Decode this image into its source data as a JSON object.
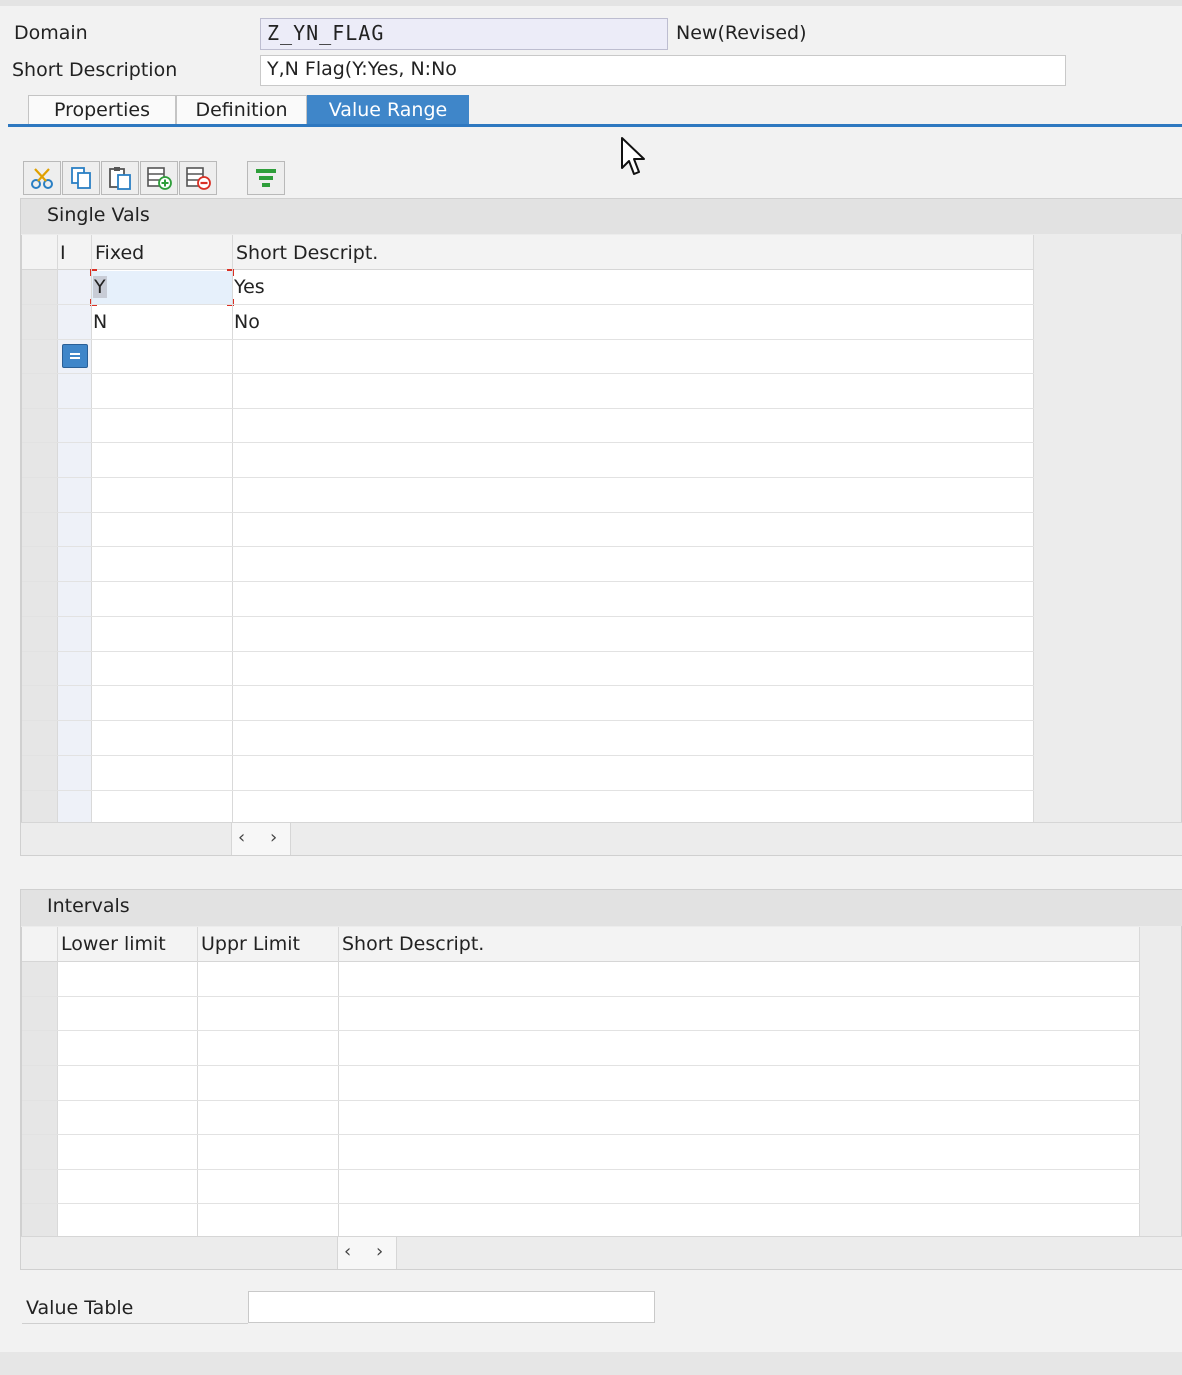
{
  "header": {
    "domain_label": "Domain",
    "domain_value": "Z_YN_FLAG",
    "status": "New(Revised)",
    "short_desc_label": "Short Description",
    "short_desc_value": "Y,N Flag(Y:Yes, N:No"
  },
  "tabs": [
    {
      "label": "Properties",
      "active": false
    },
    {
      "label": "Definition",
      "active": false
    },
    {
      "label": "Value Range",
      "active": true
    }
  ],
  "toolbar": {
    "icons": [
      "cut-icon",
      "copy-icon",
      "paste-icon",
      "insert-row-icon",
      "delete-row-icon",
      "filter-icon"
    ]
  },
  "single_vals": {
    "title": "Single Vals",
    "columns": [
      "I",
      "Fixed",
      "Short Descript."
    ],
    "rows": [
      {
        "fixed": "Y",
        "desc": "Yes"
      },
      {
        "fixed": "N",
        "desc": "No"
      }
    ]
  },
  "intervals": {
    "title": "Intervals",
    "columns": [
      "Lower limit",
      "Uppr Limit",
      "Short Descript."
    ],
    "rows": []
  },
  "value_table": {
    "label": "Value Table",
    "value": ""
  },
  "colors": {
    "accent": "#3f86c9",
    "selected_cell": "#e6f0fb",
    "focus_marker": "#d93025"
  }
}
